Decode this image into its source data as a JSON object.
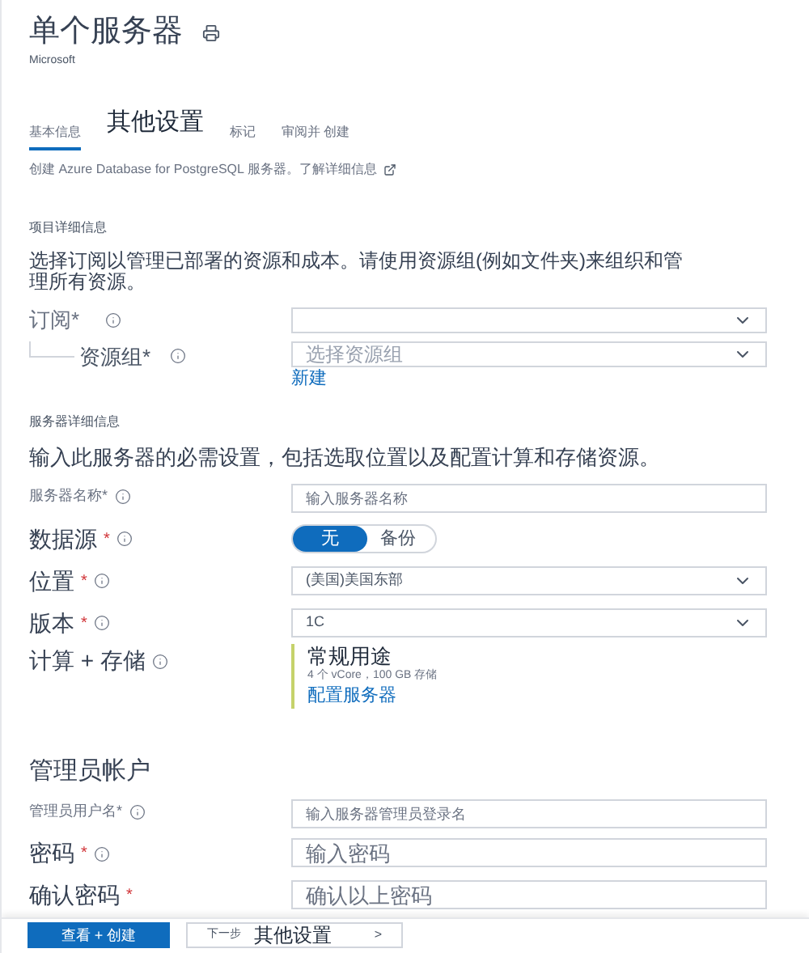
{
  "header": {
    "title": "单个服务器",
    "publisher": "Microsoft"
  },
  "tabs": [
    {
      "label": "基本信息",
      "selected": true
    },
    {
      "label": "其他设置",
      "selected": false
    },
    {
      "label": "标记",
      "selected": false
    },
    {
      "label": "审阅并 创建",
      "selected": false
    }
  ],
  "description": {
    "text": "创建 Azure Database for PostgreSQL 服务器。了解详细信息"
  },
  "project": {
    "heading": "项目详细信息",
    "intro": "选择订阅以管理已部署的资源和成本。请使用资源组(例如文件夹)来组织和管理所有资源。",
    "subscription": {
      "label": "订阅*"
    },
    "resource_group": {
      "label": "资源组*",
      "placeholder": "选择资源组",
      "create_link": "新建"
    }
  },
  "server": {
    "heading": "服务器详细信息",
    "intro": "输入此服务器的必需设置，包括选取位置以及配置计算和存储资源。",
    "fields": [
      {
        "kind": "text",
        "label": "服务器名称*",
        "info": true,
        "placeholder": "输入服务器名称"
      },
      {
        "kind": "toggle",
        "label": "数据源",
        "marker": "*",
        "info": true,
        "options": [
          {
            "label": "无",
            "selected": true
          },
          {
            "label": "备份",
            "selected": false
          }
        ]
      },
      {
        "kind": "select",
        "label": "位置",
        "marker": "*",
        "info": true,
        "value": "(美国)美国东部"
      },
      {
        "kind": "select",
        "label": "版本",
        "marker": "*",
        "info": true,
        "value": "1C"
      },
      {
        "kind": "compute",
        "label": "计算 + 存储",
        "info": true,
        "tier": "常规用途",
        "detail": "4 个 vCore，100 GB 存储",
        "link": "配置服务器"
      }
    ]
  },
  "admin": {
    "heading": "管理员帐户",
    "fields": [
      {
        "kind": "text",
        "label": "管理员用户名*",
        "info": true,
        "placeholder": "输入服务器管理员登录名"
      },
      {
        "kind": "text",
        "label": "密码",
        "marker": "*",
        "info": true,
        "placeholder": "输入密码"
      },
      {
        "kind": "text",
        "label": "确认密码",
        "marker": "*",
        "info": false,
        "placeholder": "确认以上密码"
      }
    ]
  },
  "footer": {
    "primary": "查看 + 创建",
    "secondary_prefix": "下一步",
    "secondary": "其他设置",
    "secondary_arrow": ">"
  }
}
